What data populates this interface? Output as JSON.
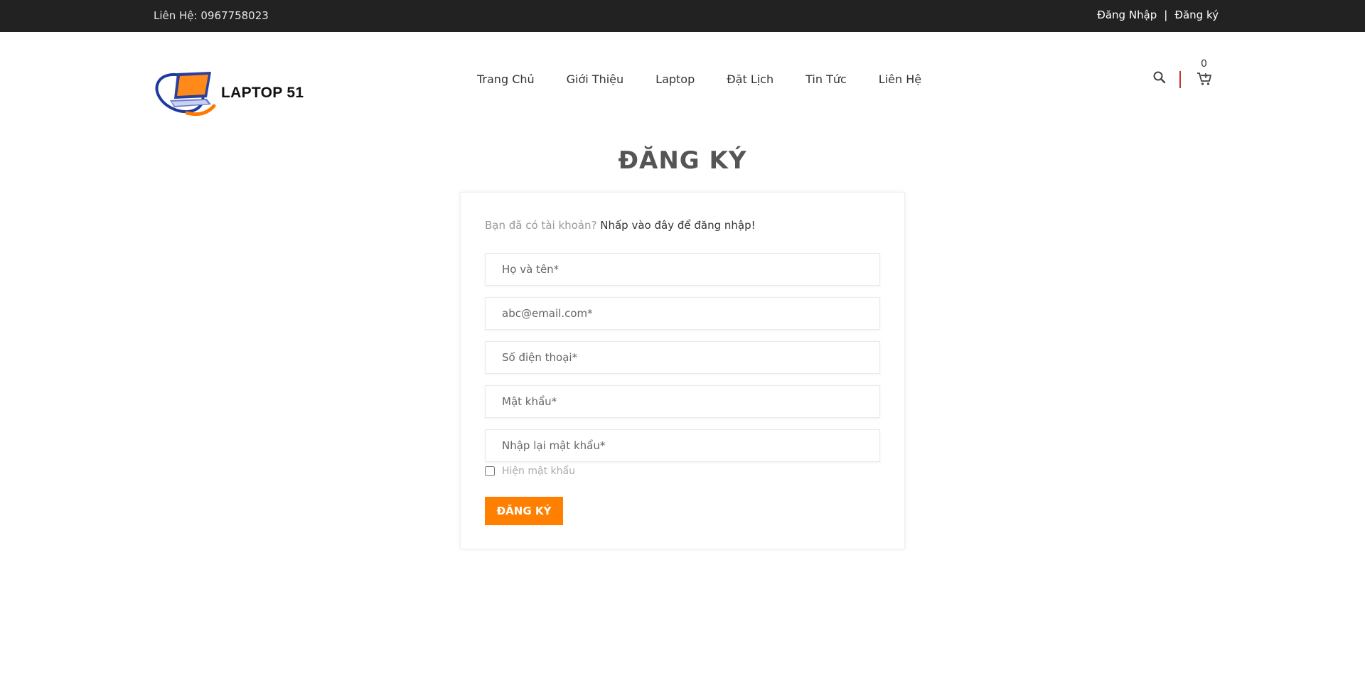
{
  "topbar": {
    "contact": "Liên Hệ: 0967758023",
    "login_link": "Đăng Nhập",
    "separator": "|",
    "register_link": "Đăng ký"
  },
  "header": {
    "brand": "LAPTOP 51",
    "nav": [
      {
        "label": "Trang Chủ"
      },
      {
        "label": "Giới Thiệu"
      },
      {
        "label": "Laptop"
      },
      {
        "label": "Đặt Lịch"
      },
      {
        "label": "Tin Tức"
      },
      {
        "label": "Liên Hệ"
      }
    ],
    "cart_count": "0",
    "icons": [
      "search-icon",
      "cart-icon"
    ]
  },
  "page": {
    "title": "ĐĂNG KÝ"
  },
  "form": {
    "hint_text": "Bạn đã có tài khoản?",
    "hint_link": "Nhấp vào đây để đăng nhập!",
    "fields": [
      {
        "placeholder": "Họ và tên*",
        "value": ""
      },
      {
        "placeholder": "abc@email.com*",
        "value": ""
      },
      {
        "placeholder": "Số điện thoại*",
        "value": ""
      },
      {
        "placeholder": "Mật khẩu*",
        "value": ""
      },
      {
        "placeholder": "Nhập lại mật khẩu*",
        "value": ""
      }
    ],
    "show_password_label": "Hiện mật khẩu",
    "submit_label": "ĐĂNG KÝ"
  },
  "colors": {
    "topbar_bg": "#222222",
    "accent": "#ff8000",
    "divider": "#c0392b"
  }
}
